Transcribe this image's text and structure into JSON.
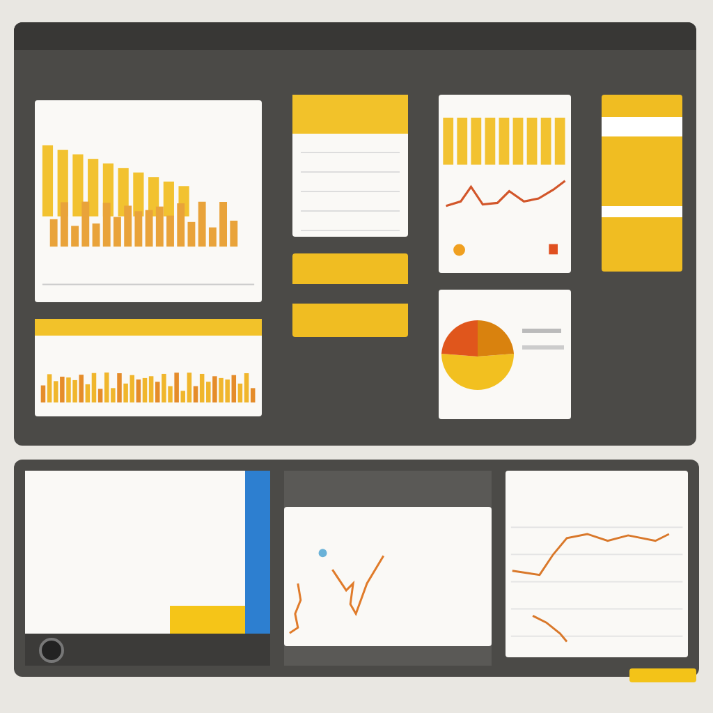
{
  "dashboard": {
    "columns": [
      {
        "panels": [
          {
            "kind": "bar_chart"
          },
          {
            "kind": "histogram_card"
          }
        ]
      },
      {
        "panels": [
          {
            "kind": "list_card"
          },
          {
            "kind": "yellow_card"
          }
        ]
      },
      {
        "panels": [
          {
            "kind": "bar_line_chart"
          },
          {
            "kind": "pie_chart"
          }
        ]
      },
      {
        "panels": [
          {
            "kind": "yellow_list"
          }
        ]
      }
    ]
  },
  "bottom": {
    "panels": [
      {
        "kind": "text_sidebar"
      },
      {
        "kind": "dark_line_chart"
      },
      {
        "kind": "line_chart"
      }
    ]
  }
}
